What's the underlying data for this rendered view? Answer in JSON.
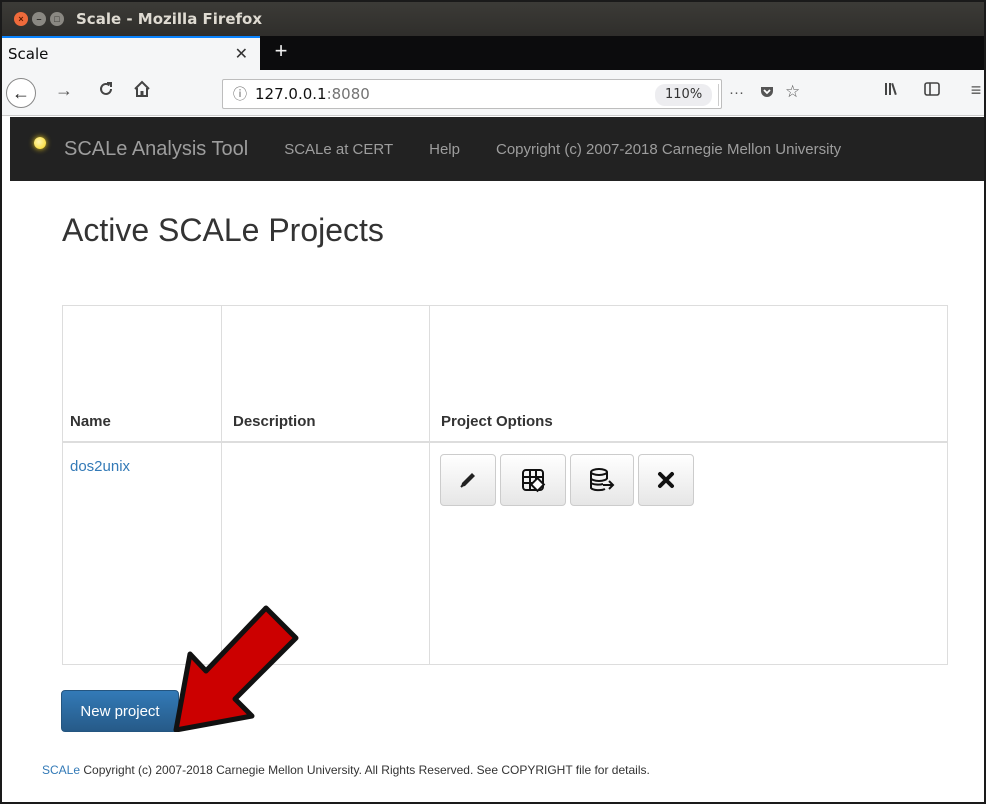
{
  "window": {
    "title": "Scale - Mozilla Firefox",
    "buttons": [
      "close",
      "minimize",
      "maximize"
    ]
  },
  "tabs": [
    {
      "title": "Scale",
      "active": true
    }
  ],
  "newtab_label": "+",
  "urlbar": {
    "host": "127.0.0.1",
    "port": ":8080",
    "zoom": "110%",
    "icons": [
      "info-icon",
      "more-actions-icon",
      "pocket-icon",
      "star-icon"
    ]
  },
  "toolbar_icons": [
    "back-icon",
    "forward-icon",
    "reload-icon",
    "home-icon",
    "library-icon",
    "sidebar-icon",
    "menu-icon"
  ],
  "appnav": {
    "brand": "SCALe Analysis Tool",
    "links": [
      "SCALe at CERT",
      "Help",
      "Copyright (c) 2007-2018 Carnegie Mellon University"
    ]
  },
  "page": {
    "title": "Active SCALe Projects",
    "columns": [
      "Name",
      "Description",
      "Project Options"
    ],
    "projects": [
      {
        "name": "dos2unix",
        "description": "",
        "options": [
          "edit-icon",
          "scan-grid-icon",
          "database-export-icon",
          "delete-icon"
        ]
      }
    ],
    "new_project_label": "New project"
  },
  "footer": {
    "scale_link": "SCALe",
    "text": " Copyright (c) 2007-2018 Carnegie Mellon University. All Rights Reserved. See COPYRIGHT file for details."
  },
  "colors": {
    "titlebar": "#3c3b37",
    "appnav_bg": "#222222",
    "link": "#337ab7",
    "primary_button": "#337ab7",
    "annotation_arrow": "#cc0000"
  }
}
